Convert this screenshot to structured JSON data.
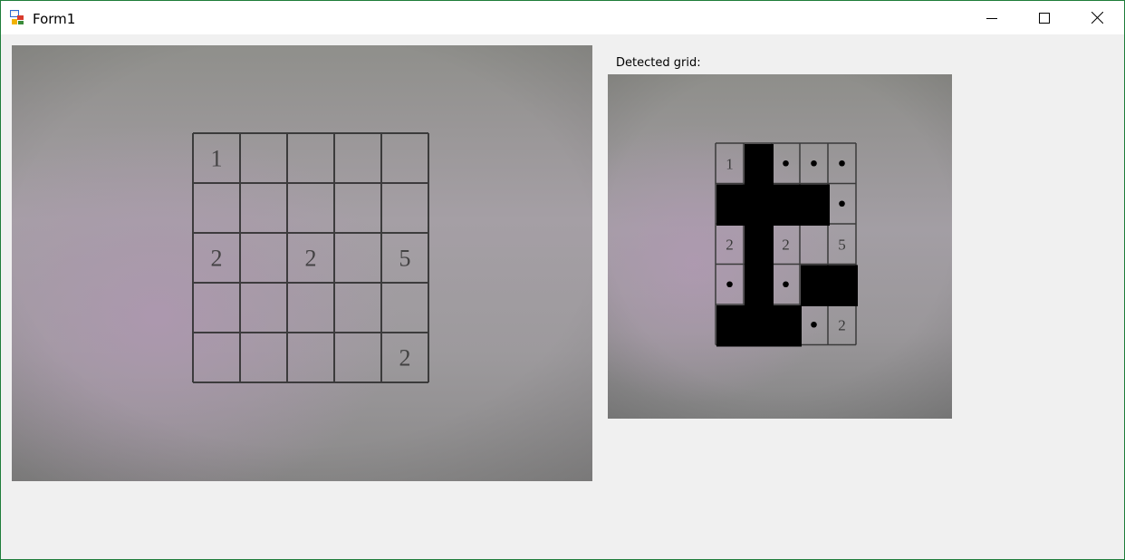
{
  "window": {
    "title": "Form1"
  },
  "controls": {
    "minimize_icon": "minimize-icon",
    "maximize_icon": "maximize-icon",
    "close_icon": "close-icon"
  },
  "camera": {
    "grid_size": [
      5,
      5
    ],
    "clues": [
      {
        "row": 0,
        "col": 0,
        "value": "1"
      },
      {
        "row": 2,
        "col": 0,
        "value": "2"
      },
      {
        "row": 2,
        "col": 2,
        "value": "2"
      },
      {
        "row": 2,
        "col": 4,
        "value": "5"
      },
      {
        "row": 4,
        "col": 4,
        "value": "2"
      }
    ]
  },
  "detected": {
    "label": "Detected grid:",
    "grid_size": [
      5,
      5
    ],
    "clues": [
      {
        "row": 0,
        "col": 0,
        "value": "1"
      },
      {
        "row": 2,
        "col": 0,
        "value": "2"
      },
      {
        "row": 2,
        "col": 2,
        "value": "2"
      },
      {
        "row": 2,
        "col": 4,
        "value": "5"
      },
      {
        "row": 4,
        "col": 4,
        "value": "2"
      }
    ],
    "black_cells": [
      [
        0,
        1
      ],
      [
        1,
        0
      ],
      [
        1,
        1
      ],
      [
        1,
        2
      ],
      [
        1,
        3
      ],
      [
        2,
        1
      ],
      [
        3,
        1
      ],
      [
        3,
        3
      ],
      [
        3,
        4
      ],
      [
        4,
        0
      ],
      [
        4,
        1
      ],
      [
        4,
        2
      ]
    ],
    "dot_cells": [
      [
        0,
        2
      ],
      [
        0,
        3
      ],
      [
        0,
        4
      ],
      [
        1,
        4
      ],
      [
        3,
        0
      ],
      [
        3,
        2
      ],
      [
        4,
        3
      ]
    ]
  },
  "colors": {
    "window_border": "#1e7d3a",
    "black_fill": "#000000",
    "form_bg": "#f0f0f0"
  }
}
